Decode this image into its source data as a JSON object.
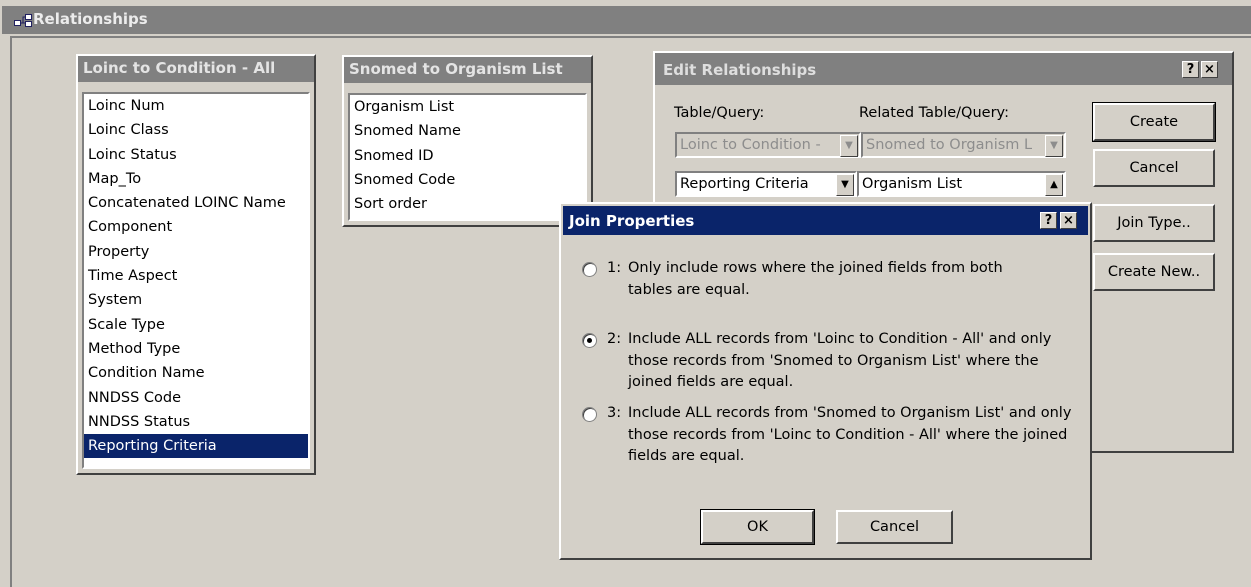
{
  "window": {
    "title": "Relationships",
    "icon": "relationships-icon"
  },
  "loinc_table": {
    "title": "Loinc to Condition - All",
    "fields": [
      "Loinc Num",
      "Loinc Class",
      "Loinc Status",
      "Map_To",
      "Concatenated LOINC Name",
      "Component",
      "Property",
      "Time Aspect",
      "System",
      "Scale Type",
      "Method Type",
      "Condition Name",
      "NNDSS Code",
      "NNDSS Status",
      "Reporting Criteria"
    ],
    "selected_index": 14
  },
  "snomed_table": {
    "title": "Snomed to Organism List",
    "fields": [
      "Organism List",
      "Snomed Name",
      "Snomed ID",
      "Snomed Code",
      "Sort order"
    ]
  },
  "edit_relationships": {
    "title": "Edit Relationships",
    "help_glyph": "?",
    "close_glyph": "×",
    "table_label": "Table/Query:",
    "related_label": "Related Table/Query:",
    "table_value": "Loinc to Condition -",
    "related_value": "Snomed to Organism L",
    "field_left": "Reporting Criteria",
    "field_right": "Organism List",
    "buttons": {
      "create": "Create",
      "cancel": "Cancel",
      "join_type": "Join Type..",
      "create_new": "Create New.."
    }
  },
  "join_properties": {
    "title": "Join Properties",
    "help_glyph": "?",
    "close_glyph": "×",
    "selected_option": 2,
    "option1_num": "1:",
    "option1_text": "Only include rows where the joined fields from both tables are equal.",
    "option2_num": "2:",
    "option2_text": "Include ALL records from 'Loinc to Condition - All' and only those records from 'Snomed to Organism List' where the joined fields are equal.",
    "option3_num": "3:",
    "option3_text": "Include ALL records from 'Snomed to Organism List' and only those records from 'Loinc to Condition - All' where the joined fields are equal.",
    "ok_label": "OK",
    "cancel_label": "Cancel"
  }
}
